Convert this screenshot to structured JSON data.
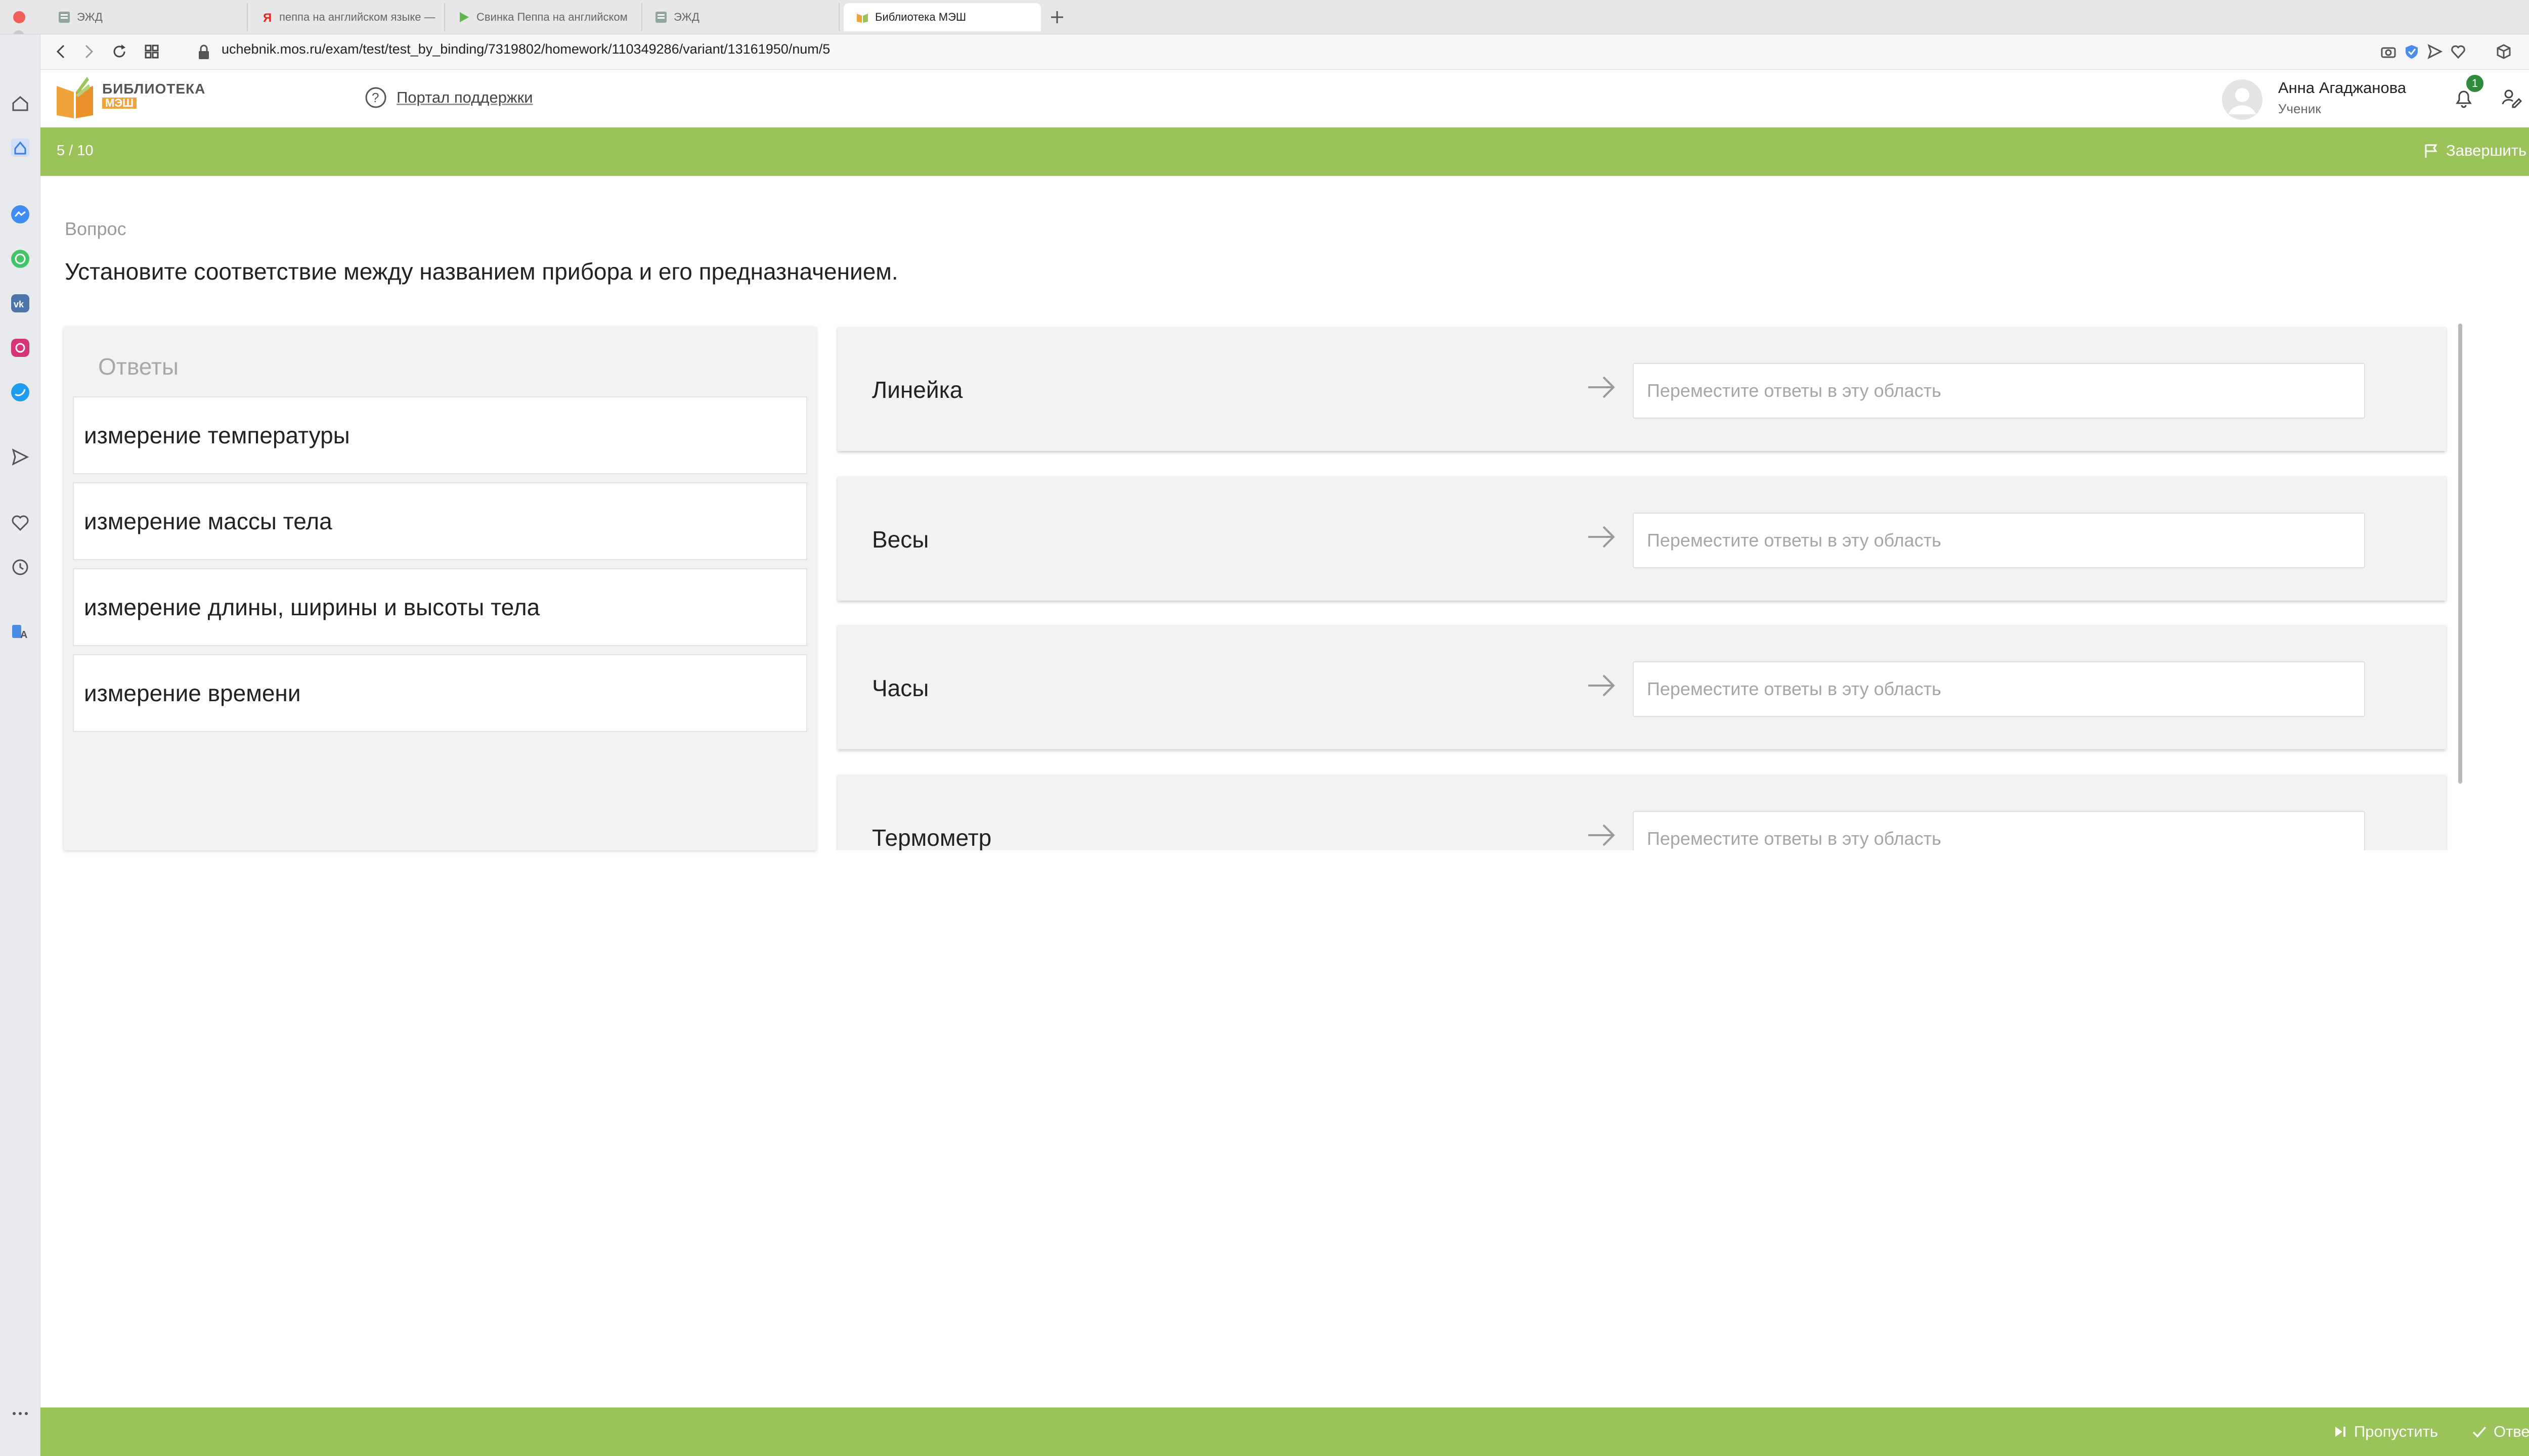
{
  "browser": {
    "tabs": [
      {
        "title": "ЭЖД",
        "icon": "edj-icon",
        "active": false
      },
      {
        "title": "пеппа на английском языке —",
        "icon": "yandex-icon",
        "active": false
      },
      {
        "title": "Свинка Пеппа на английском",
        "icon": "video-play-icon",
        "active": false
      },
      {
        "title": "ЭЖД",
        "icon": "edj-icon",
        "active": false
      },
      {
        "title": "Библиотека МЭШ",
        "icon": "library-icon",
        "active": true
      }
    ],
    "url": "uchebnik.mos.ru/exam/test/test_by_binding/7319802/homework/110349286/variant/13161950/num/5"
  },
  "header": {
    "logo_line1": "БИБЛИОТЕКА",
    "logo_line2": "МЭШ",
    "support_label": "Портал поддержки",
    "user_name": "Анна Агаджанова",
    "user_role": "Ученик",
    "notifications_count": "1"
  },
  "progress": {
    "counter": "5 / 10",
    "finish_label": "Завершить тест"
  },
  "question": {
    "label": "Вопрос",
    "text": "Установите соответствие между названием прибора и его предназначением."
  },
  "answers": {
    "title": "Ответы",
    "items": [
      "измерение температуры",
      "измерение массы тела",
      "измерение длины, ширины и высоты тела",
      "измерение времени"
    ]
  },
  "targets": [
    {
      "label": "Линейка",
      "placeholder": "Переместите ответы в эту область"
    },
    {
      "label": "Весы",
      "placeholder": "Переместите ответы в эту область"
    },
    {
      "label": "Часы",
      "placeholder": "Переместите ответы в эту область"
    },
    {
      "label": "Термометр",
      "placeholder": "Переместите ответы в эту область"
    }
  ],
  "footer": {
    "skip_label": "Пропустить",
    "answer_label": "Ответить"
  },
  "colors": {
    "accent_green": "#9ac35a",
    "logo_orange": "#f0a33a"
  }
}
